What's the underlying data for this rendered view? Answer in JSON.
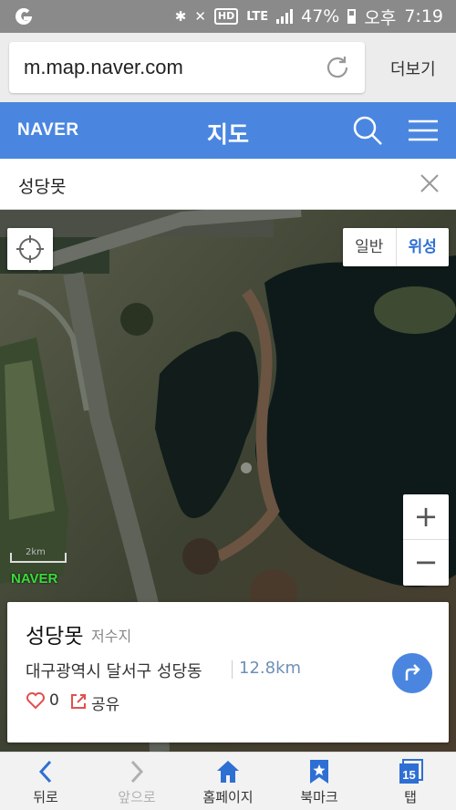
{
  "status_bar": {
    "battery": "47%",
    "ampm": "오후",
    "time": "7:19",
    "hd_label": "HD",
    "network": "LTE"
  },
  "browser": {
    "url": "m.map.naver.com",
    "more_label": "더보기"
  },
  "header": {
    "logo": "NAVER",
    "title": "지도",
    "accent_color": "#4a86e0"
  },
  "search": {
    "query": "성당못"
  },
  "map": {
    "type_normal": "일반",
    "type_satellite": "위성",
    "active_type": "위성",
    "zoom_in": "+",
    "zoom_out": "−",
    "watermark": "NAVER",
    "scale_label": "2km"
  },
  "place": {
    "name": "성당못",
    "category": "저수지",
    "address": "대구광역시 달서구 성당동",
    "distance": "12.8km",
    "likes": "0",
    "share_label": "공유"
  },
  "bottom_nav": {
    "back": "뒤로",
    "forward": "앞으로",
    "home": "홈페이지",
    "bookmark": "북마크",
    "tabs": "탭",
    "tab_count": "15"
  }
}
